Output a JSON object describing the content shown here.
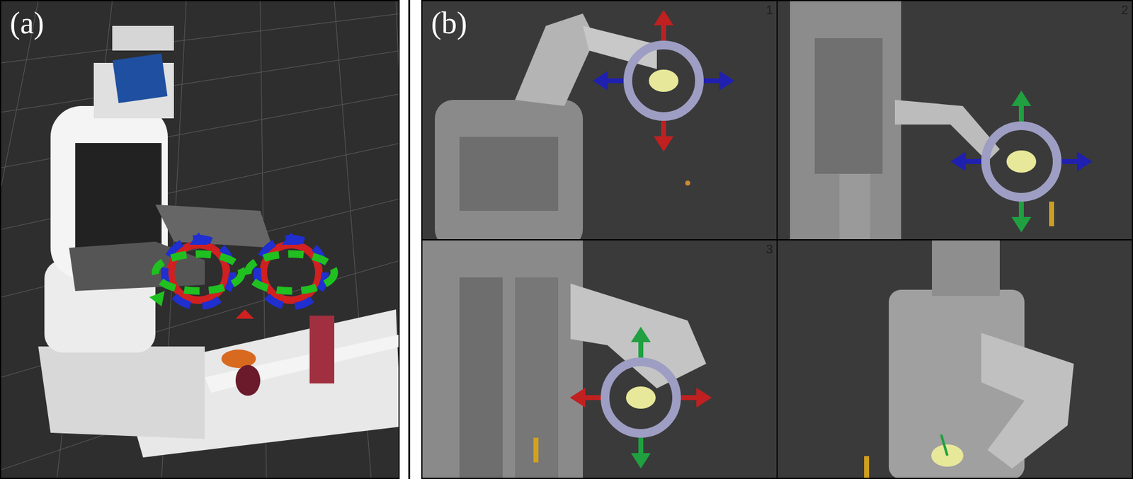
{
  "panels": [
    {
      "label": "(a)"
    },
    {
      "label": "(b)",
      "viewports": [
        {
          "number": "1"
        },
        {
          "number": "2"
        },
        {
          "number": "3"
        },
        {}
      ]
    }
  ]
}
